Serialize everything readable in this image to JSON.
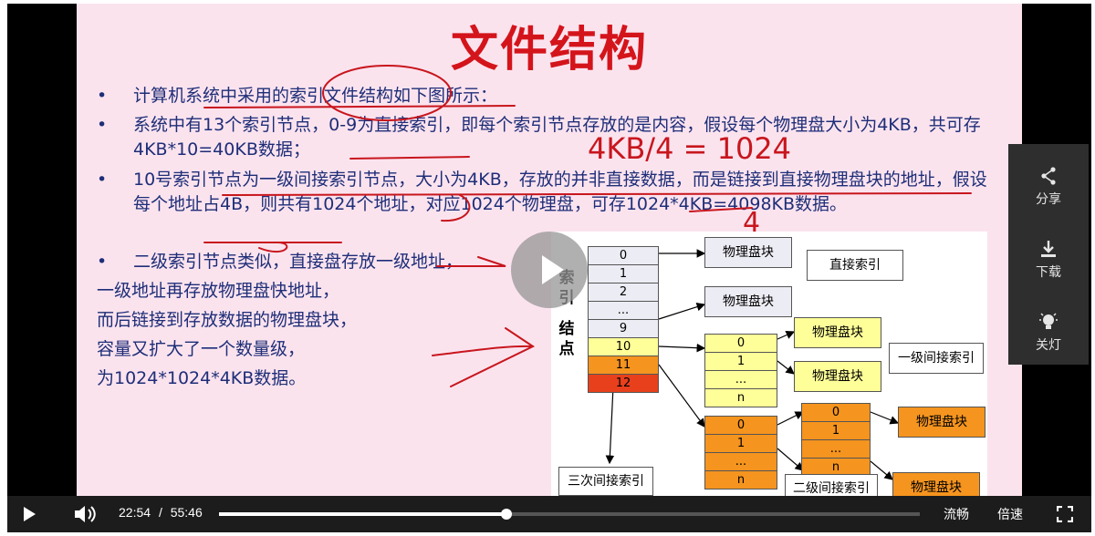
{
  "slide": {
    "title": "文件结构",
    "bullets": [
      {
        "dot": "•",
        "text": "计算机系统中采用的索引文件结构如下图所示："
      },
      {
        "dot": "•",
        "text": "系统中有13个索引节点，0-9为直接索引，即每个索引节点存放的是内容，假设每个物理盘大小为4KB，共可存4KB*10=40KB数据；"
      },
      {
        "dot": "•",
        "text": "10号索引节点为一级间接索引节点，大小为4KB，存放的并非直接数据，而是链接到直接物理盘块的地址，假设每个地址占4B，则共有1024个地址，对应1024个物理盘，可存1024*4KB=4098KB数据。"
      },
      {
        "dot": "•",
        "text": "二级索引节点类似，直接盘存放一级地址，"
      }
    ],
    "plain_lines": [
      "一级地址再存放物理盘快地址，",
      "而后链接到存放数据的物理盘块，",
      "容量又扩大了一个数量级，",
      "为1024*1024*4KB数据。"
    ],
    "annotations": {
      "calc": "4KB/4 = 1024",
      "note": "4"
    }
  },
  "diagram": {
    "index_label": [
      "索",
      "引",
      "结",
      "点"
    ],
    "index_cells": [
      "0",
      "1",
      "2",
      "...",
      "9",
      "10",
      "11",
      "12"
    ],
    "index_colors": [
      "#ececf4",
      "#ececf4",
      "#ececf4",
      "#ececf4",
      "#ececf4",
      "#ffff99",
      "#f5941e",
      "#e8401c"
    ],
    "block_label": "物理盘块",
    "direct_label": "直接索引",
    "level1_label": "一级间接索引",
    "level2_label": "二级间接索引",
    "level3_label": "三次间接索引",
    "level1_cells": [
      "0",
      "1",
      "...",
      "n"
    ],
    "level2a_cells": [
      "0",
      "1",
      "...",
      "n"
    ],
    "level2b_cells": [
      "0",
      "1",
      "...",
      "n"
    ]
  },
  "side_panel": {
    "share": "分享",
    "download": "下载",
    "lights_off": "关灯"
  },
  "controls": {
    "current_time": "22:54",
    "separator": "/",
    "total_time": "55:46",
    "progress_fraction": 0.41,
    "quality": "流畅",
    "speed": "倍速"
  }
}
